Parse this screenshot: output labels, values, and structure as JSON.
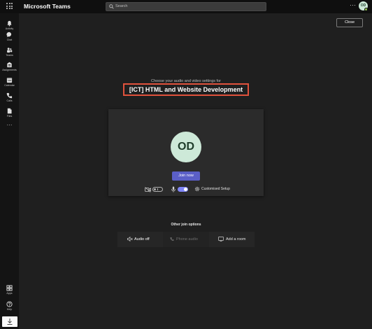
{
  "app": {
    "title": "Microsoft Teams",
    "search_placeholder": "Search",
    "more": "···",
    "user_initials": "OD"
  },
  "rail": {
    "items": [
      {
        "label": "Activity",
        "icon": "bell-icon"
      },
      {
        "label": "Chat",
        "icon": "chat-icon"
      },
      {
        "label": "Teams",
        "icon": "teams-icon"
      },
      {
        "label": "Assignments",
        "icon": "assignments-icon"
      },
      {
        "label": "Calendar",
        "icon": "calendar-icon"
      },
      {
        "label": "Calls",
        "icon": "phone-icon"
      },
      {
        "label": "Files",
        "icon": "file-icon"
      }
    ],
    "more": "···",
    "bottom": [
      {
        "label": "Apps",
        "icon": "apps-icon"
      },
      {
        "label": "Help",
        "icon": "help-icon"
      }
    ]
  },
  "prejoin": {
    "close_label": "Close",
    "subtitle": "Choose your audio and video settings for",
    "meeting_title": "[ICT] HTML and Website Development",
    "avatar_initials": "OD",
    "join_label": "Join now",
    "camera_on": false,
    "mic_on": true,
    "setup_label": "Customised Setup"
  },
  "other_options": {
    "heading": "Other join options",
    "items": [
      {
        "label": "Audio off",
        "enabled": true
      },
      {
        "label": "Phone audio",
        "enabled": false
      },
      {
        "label": "Add a room",
        "enabled": true
      }
    ]
  },
  "colors": {
    "accent": "#5b5fc7",
    "toggle_on": "#7f85f5",
    "highlight_border": "#e0523c",
    "avatar_bg": "#cde9d8"
  }
}
